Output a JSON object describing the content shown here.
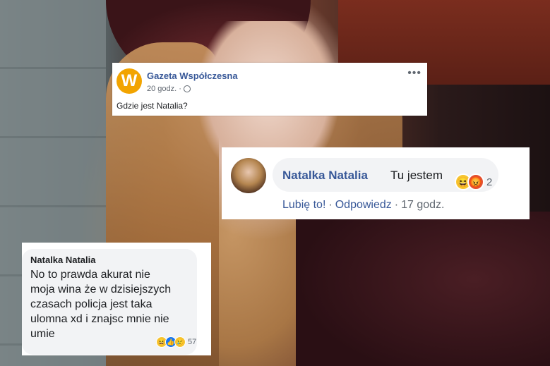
{
  "post": {
    "page_name": "Gazeta Współczesna",
    "time": "20 godz. ·",
    "text": "Gdzie jest Natalia?",
    "more": "•••",
    "logo_letter": "W",
    "logo_color": "#f2a400"
  },
  "comment_top": {
    "author": "Natalka Natalia",
    "text": "Tu jestem",
    "reactions": [
      "haha",
      "angry"
    ],
    "reaction_count": "2",
    "actions": {
      "like": "Lubię to!",
      "separator": "·",
      "reply": "Odpowiedz",
      "time": "17 godz."
    }
  },
  "comment_bottom": {
    "author": "Natalka Natalia",
    "text": "No to prawda akurat nie moja wina że w dzisiejszych czasach policja jest taka ulomna xd i znajsc mnie nie umie",
    "reactions": [
      "haha",
      "like",
      "sad"
    ],
    "reaction_count": "57"
  },
  "colors": {
    "link_blue": "#385898",
    "bubble_gray": "#f2f3f5",
    "like_blue": "#1877f2"
  }
}
